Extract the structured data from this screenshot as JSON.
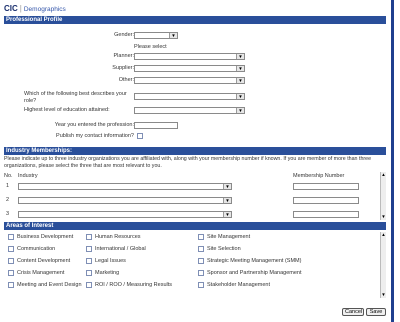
{
  "header": {
    "brand": "CIC",
    "separator": "|",
    "subtitle": "Demographics"
  },
  "professional_profile": {
    "title": "Professional Profile",
    "gender_label": "Gender:",
    "please_select": "Please select",
    "planner_label": "Planner:",
    "supplier_label": "Supplier:",
    "other_label": "Other:",
    "role_label": "Which of the following best describes your role?",
    "education_label": "Highest level of education attained:",
    "year_label": "Year you entered the profession:",
    "publish_label": "Publish my contact information?"
  },
  "industry": {
    "title": "Industry Memberships:",
    "instructions": "Please indicate up to three industry organizations you are affiliated with, along with your membership number if known. If you are member of more than three organizations, please select the three that are most relevant to you.",
    "col_no": "No.",
    "col_industry": "Industry",
    "col_membership": "Membership Number",
    "rows": [
      "1",
      "2",
      "3"
    ]
  },
  "areas": {
    "title": "Areas of Interest",
    "col1": [
      "Business Development",
      "Communication",
      "Content Development",
      "Crisis Management",
      "Meeting and Event Design"
    ],
    "col2": [
      "Human Resources",
      "International / Global",
      "Legal Issues",
      "Marketing",
      "ROI / ROO / Measuring Results"
    ],
    "col3": [
      "Site Management",
      "Site Selection",
      "Strategic Meeting Management (SMM)",
      "Sponsor and Partnership Management",
      "Stakeholder Management"
    ]
  },
  "buttons": {
    "cancel": "Cancel",
    "save": "Save"
  }
}
